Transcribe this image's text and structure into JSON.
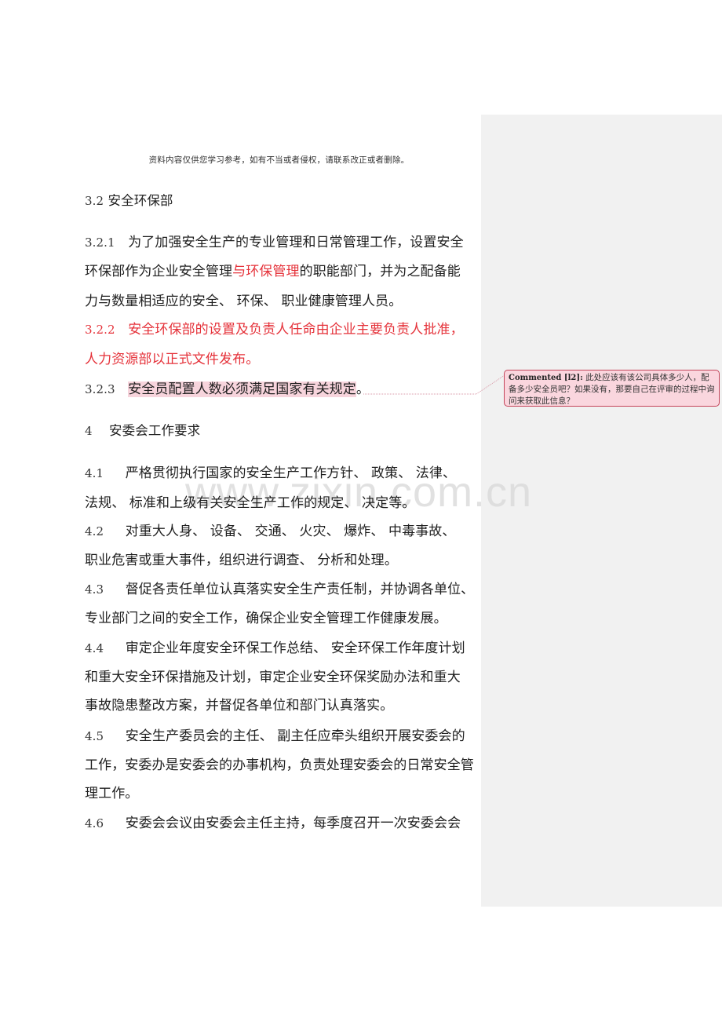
{
  "header_note": "资料内容仅供您学习参考，如有不当或者侵权，请联系改正或者删除。",
  "watermark": "www.zixin.com.cn",
  "section_3_2": {
    "heading_num": "3.2",
    "heading": "安全环保部",
    "p1": {
      "num": "3.2.1",
      "line1": "为了加强安全生产的专业管理和日常管理工作，设置安全",
      "line2_a": "环保部作为企业安全管理",
      "line2_red": "与环保管理",
      "line2_b": "的职能部门，并为之配备能",
      "line3": "力与数量相适应的安全、 环保、 职业健康管理人员。"
    },
    "p2": {
      "num": "3.2.2",
      "line1": "安全环保部的设置及负责人任命由企业主要负责人批准，",
      "line2": "人力资源部以正式文件发布。"
    },
    "p3": {
      "num": "3.2.3",
      "highlighted": "安全员配置人数必须满足国家有关规定",
      "tail": "。"
    }
  },
  "section_4": {
    "heading_num": "4",
    "heading": "安委会工作要求",
    "items": [
      {
        "num": "4.1",
        "lines": [
          "严格贯彻执行国家的安全生产工作方针、 政策、 法律、",
          "法规、 标准和上级有关安全生产工作的规定、 决定等。"
        ]
      },
      {
        "num": "4.2",
        "lines": [
          "对重大人身、 设备、 交通、 火灾、 爆炸、 中毒事故、",
          "职业危害或重大事件，组织进行调查、 分析和处理。"
        ]
      },
      {
        "num": "4.3",
        "lines": [
          "督促各责任单位认真落实安全生产责任制，并协调各单位、",
          "专业部门之间的安全工作，确保企业安全管理工作健康发展。"
        ]
      },
      {
        "num": "4.4",
        "lines": [
          "审定企业年度安全环保工作总结、 安全环保工作年度计划",
          "和重大安全环保措施及计划，审定企业安全环保奖励办法和重大",
          "事故隐患整改方案，并督促各单位和部门认真落实。"
        ]
      },
      {
        "num": "4.5",
        "lines": [
          "安全生产委员会的主任、 副主任应牵头组织开展安委会的",
          "工作，安委办是安委会的办事机构，负责处理安委会的日常安全管",
          "理工作。"
        ]
      },
      {
        "num": "4.6",
        "lines": [
          "安委会会议由安委会主任主持，每季度召开一次安委会会"
        ]
      }
    ]
  },
  "comment": {
    "author": "Commented [l2]:",
    "text": " 此处应该有该公司具体多少人，配备多少安全员吧？如果没有，那要自己在评审的过程中询问来获取此信息？"
  },
  "colors": {
    "revision_red": "#e5323a",
    "comment_fill": "#fad6de",
    "comment_border": "#c4445a",
    "comment_pane": "#f1f1f1"
  }
}
